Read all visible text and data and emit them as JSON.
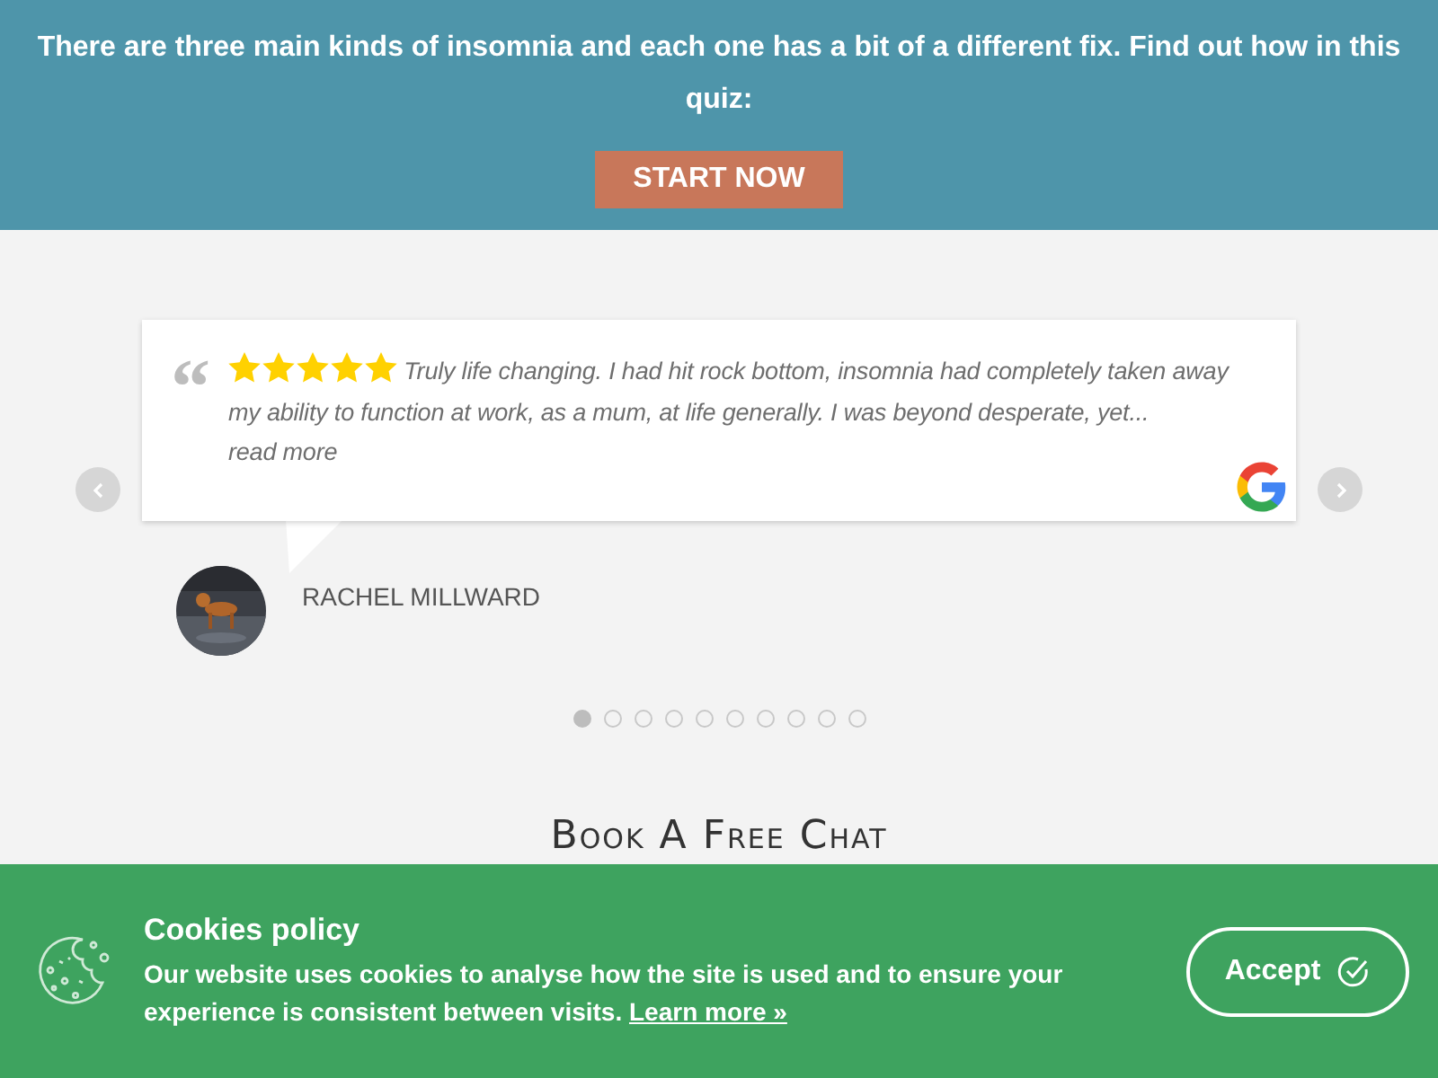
{
  "promo": {
    "text": "There are three main kinds of insomnia and each one has a bit of a different fix. Find out how in this quiz:",
    "button": "START NOW"
  },
  "testimonial": {
    "quote_mark": "“",
    "stars": 5,
    "text": "Truly life changing. I had hit rock bottom, insomnia had completely taken away my ability to function at work, as a mum, at life generally. I was beyond desperate, yet...",
    "read_more": "read more",
    "author": "RACHEL MILLWARD"
  },
  "carousel": {
    "dots": [
      {
        "selected": true
      },
      {
        "selected": false
      },
      {
        "selected": false
      },
      {
        "selected": false
      },
      {
        "selected": false
      },
      {
        "selected": false
      },
      {
        "selected": false
      },
      {
        "selected": false
      },
      {
        "selected": false
      },
      {
        "selected": false
      }
    ]
  },
  "section_heading": "Book A Free Chat",
  "cookie_banner": {
    "title": "Cookies policy",
    "text": "Our website uses cookies to analyse how the site is used and to ensure your experience is consistent between visits.",
    "link": "Learn more »",
    "button": "Accept"
  }
}
